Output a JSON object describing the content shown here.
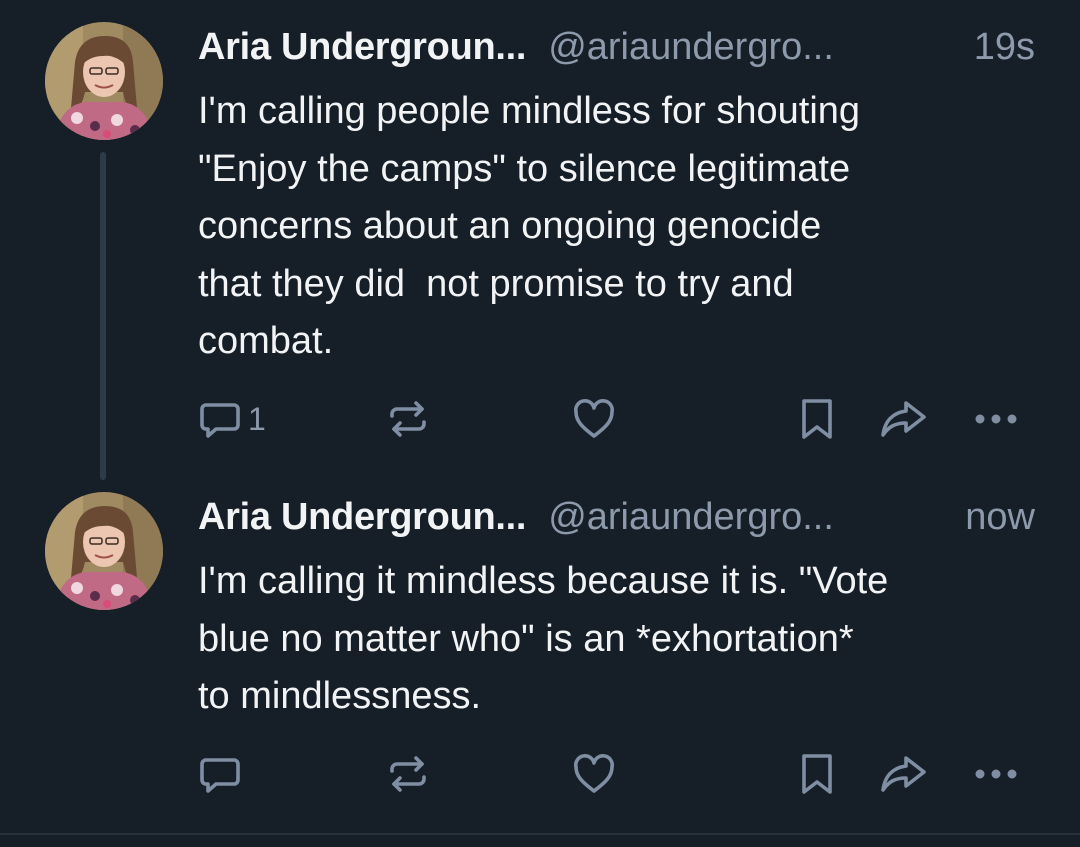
{
  "posts": [
    {
      "author_name": "Aria Undergroun...",
      "handle": "@ariaundergro...",
      "time": "19s",
      "text": "I'm calling people mindless for shouting\n\"Enjoy the camps\" to silence legitimate\nconcerns about an ongoing genocide\nthat they did  not promise to try and\ncombat.",
      "reply_count": "1",
      "avatar_icon": "avatar-photo"
    },
    {
      "author_name": "Aria Undergroun...",
      "handle": "@ariaundergro...",
      "time": "now",
      "text": "I'm calling it mindless because it is. \"Vote\nblue no matter who\" is an *exhortation*\nto mindlessness.",
      "reply_count": "",
      "avatar_icon": "avatar-photo"
    }
  ],
  "action_icons": [
    "reply-icon",
    "repost-icon",
    "like-icon",
    "bookmark-icon",
    "share-icon",
    "more-icon"
  ],
  "colors": {
    "background": "#161e27",
    "text": "#f1f3f5",
    "muted": "#8d9aab",
    "icon": "#7f8ea2",
    "thread_line": "#2e3a47"
  }
}
